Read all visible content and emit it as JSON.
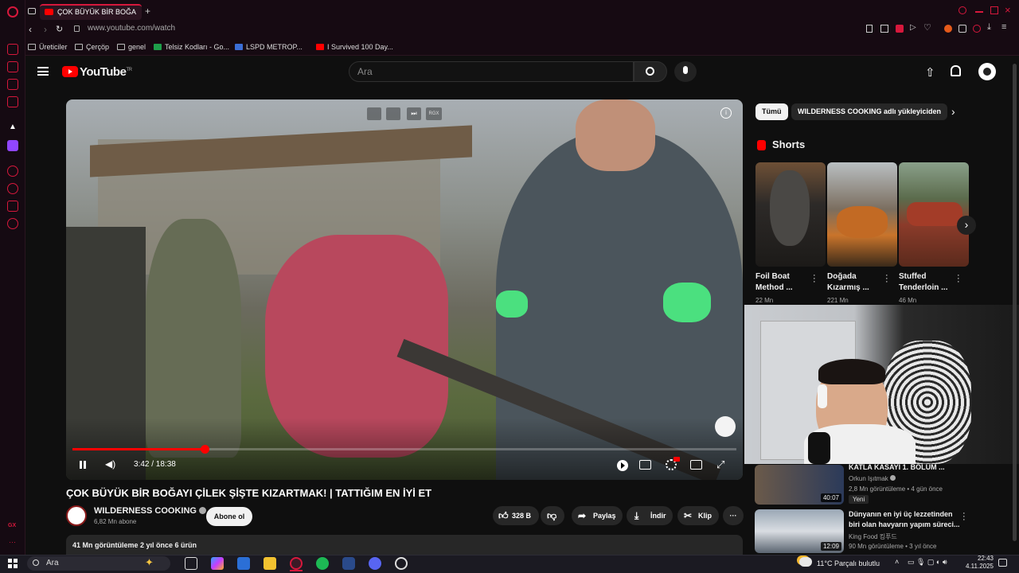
{
  "browser": {
    "tab_title": "ÇOK BÜYÜK BİR BOĞA",
    "url": "www.youtube.com/watch",
    "bookmarks": [
      "Üreticiler",
      "Çerçöp",
      "genel",
      "Telsiz Kodları - Go...",
      "LSPD METROP...",
      "I Survived 100 Day..."
    ]
  },
  "youtube": {
    "logo": "YouTube",
    "logo_sup": "TR",
    "search_placeholder": "Ara"
  },
  "player": {
    "time": "3:42 / 18:38",
    "progress_fraction": 0.199
  },
  "video": {
    "title": "ÇOK BÜYÜK BİR BOĞAYI ÇİLEK ŞİŞTE KIZARTMAK! | TATTIĞIM EN İYİ ET",
    "channel": "WILDERNESS COOKING",
    "subscribers": "6,82 Mn abone",
    "subscribe_label": "Abone ol",
    "likes": "328 B",
    "share": "Paylaş",
    "download": "İndir",
    "clip": "Klip",
    "description_meta": "41 Mn görüntüleme  2 yıl önce  6 ürün"
  },
  "sidebar": {
    "chips": [
      "Tümü",
      "WILDERNESS COOKING adlı yükleyiciden"
    ],
    "shorts_heading": "Shorts",
    "shorts": [
      {
        "title": "Foil Boat Method ...",
        "views": "22 Mn"
      },
      {
        "title": "Doğada Kızarmış ...",
        "views": "221 Mn"
      },
      {
        "title": "Stuffed Tenderloin ...",
        "views": "46 Mn"
      }
    ],
    "related": [
      {
        "title": "KATLA KASAYI 1. BÖLÜM ...",
        "channel": "Orkun Işıtmak",
        "meta": "2,8 Mn görüntüleme • 4 gün önce",
        "badge": "Yeni",
        "duration": "40:07"
      },
      {
        "title": "Dünyanın en iyi üç lezzetinden biri olan havyarın yapım süreci...",
        "channel": "King Food 킹푸드",
        "meta": "90 Mn görüntüleme • 3 yıl önce",
        "duration": "12:09"
      }
    ]
  },
  "taskbar": {
    "search": "Ara",
    "weather_temp": "11°C",
    "weather_desc": "Parçalı bulutlu",
    "time": "22:43",
    "date": "4.11.2025"
  }
}
